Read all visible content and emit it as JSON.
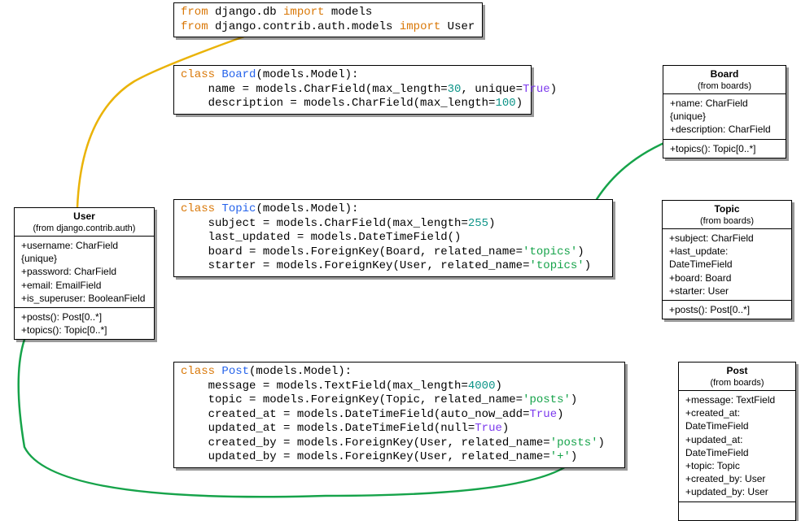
{
  "code": {
    "imports": [
      {
        "t": "from",
        "c": "kw-orange"
      },
      {
        "t": " django.db "
      },
      {
        "t": "import",
        "c": "kw-orange"
      },
      {
        "t": " models\n"
      },
      {
        "t": "from",
        "c": "kw-orange"
      },
      {
        "t": " django.contrib.auth.models "
      },
      {
        "t": "import",
        "c": "kw-orange"
      },
      {
        "t": " User"
      }
    ],
    "board": [
      {
        "t": "class",
        "c": "kw-orange"
      },
      {
        "t": " "
      },
      {
        "t": "Board",
        "c": "kw-blue"
      },
      {
        "t": "(models.Model):\n    name = models.CharField(max_length="
      },
      {
        "t": "30",
        "c": "kw-teal"
      },
      {
        "t": ", unique="
      },
      {
        "t": "True",
        "c": "kw-purple"
      },
      {
        "t": ")\n    description = models.CharField(max_length="
      },
      {
        "t": "100",
        "c": "kw-teal"
      },
      {
        "t": ")"
      }
    ],
    "topic": [
      {
        "t": "class",
        "c": "kw-orange"
      },
      {
        "t": " "
      },
      {
        "t": "Topic",
        "c": "kw-blue"
      },
      {
        "t": "(models.Model):\n    subject = models.CharField(max_length="
      },
      {
        "t": "255",
        "c": "kw-teal"
      },
      {
        "t": ")\n    last_updated = models.DateTimeField()\n    board = models.ForeignKey(Board, related_name="
      },
      {
        "t": "'topics'",
        "c": "kw-green"
      },
      {
        "t": ")\n    starter = models.ForeignKey(User, related_name="
      },
      {
        "t": "'topics'",
        "c": "kw-green"
      },
      {
        "t": ")"
      }
    ],
    "post": [
      {
        "t": "class",
        "c": "kw-orange"
      },
      {
        "t": " "
      },
      {
        "t": "Post",
        "c": "kw-blue"
      },
      {
        "t": "(models.Model):\n    message = models.TextField(max_length="
      },
      {
        "t": "4000",
        "c": "kw-teal"
      },
      {
        "t": ")\n    topic = models.ForeignKey(Topic, related_name="
      },
      {
        "t": "'posts'",
        "c": "kw-green"
      },
      {
        "t": ")\n    created_at = models.DateTimeField(auto_now_add="
      },
      {
        "t": "True",
        "c": "kw-purple"
      },
      {
        "t": ")\n    updated_at = models.DateTimeField(null="
      },
      {
        "t": "True",
        "c": "kw-purple"
      },
      {
        "t": ")\n    created_by = models.ForeignKey(User, related_name="
      },
      {
        "t": "'posts'",
        "c": "kw-green"
      },
      {
        "t": ")\n    updated_by = models.ForeignKey(User, related_name="
      },
      {
        "t": "'+'",
        "c": "kw-green"
      },
      {
        "t": ")"
      }
    ]
  },
  "uml": {
    "user": {
      "title": "User",
      "subtitle": "(from django.contrib.auth)",
      "attrs": [
        "+username: CharField {unique}",
        "+password: CharField",
        "+email: EmailField",
        "+is_superuser: BooleanField"
      ],
      "methods": [
        "+posts(): Post[0..*]",
        "+topics(): Topic[0..*]"
      ]
    },
    "board": {
      "title": "Board",
      "subtitle": "(from boards)",
      "attrs": [
        "+name: CharField {unique}",
        "+description: CharField"
      ],
      "methods": [
        "+topics(): Topic[0..*]"
      ]
    },
    "topic": {
      "title": "Topic",
      "subtitle": "(from boards)",
      "attrs": [
        "+subject: CharField",
        "+last_update: DateTimeField",
        "+board: Board",
        "+starter: User"
      ],
      "methods": [
        "+posts(): Post[0..*]"
      ]
    },
    "post": {
      "title": "Post",
      "subtitle": "(from boards)",
      "attrs": [
        "+message: TextField",
        "+created_at: DateTimeField",
        "+updated_at: DateTimeField",
        "+topic: Topic",
        "+created_by: User",
        "+updated_by: User"
      ],
      "methods": []
    }
  }
}
